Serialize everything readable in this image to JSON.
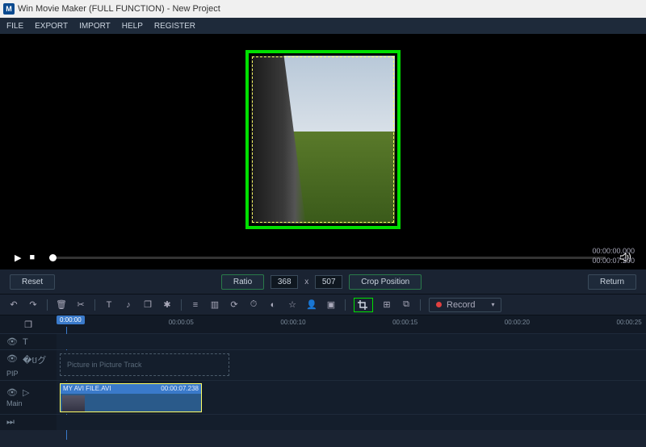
{
  "title": "Win Movie Maker (FULL FUNCTION) - New Project",
  "logo_letter": "M",
  "menu": [
    "FILE",
    "EXPORT",
    "IMPORT",
    "HELP",
    "REGISTER"
  ],
  "time": {
    "current": "00:00:00.000",
    "total": "00:00:07.200"
  },
  "crop": {
    "reset": "Reset",
    "ratio": "Ratio",
    "w": "368",
    "x": "x",
    "h": "507",
    "position": "Crop Position",
    "return": "Return"
  },
  "record": {
    "label": "Record"
  },
  "playhead": "0:00:00",
  "ruler": [
    {
      "t": "00:00:05",
      "pct": 19
    },
    {
      "t": "00:00:10",
      "pct": 38
    },
    {
      "t": "00:00:15",
      "pct": 57
    },
    {
      "t": "00:00:20",
      "pct": 76
    },
    {
      "t": "00:00:25",
      "pct": 95
    }
  ],
  "tracks": {
    "pip_label": "PIP",
    "pip_placeholder": "Picture in Picture Track",
    "main_label": "Main",
    "clip_name": "MY AVI FILE.AVI",
    "clip_dur": "00:00:07.238"
  }
}
